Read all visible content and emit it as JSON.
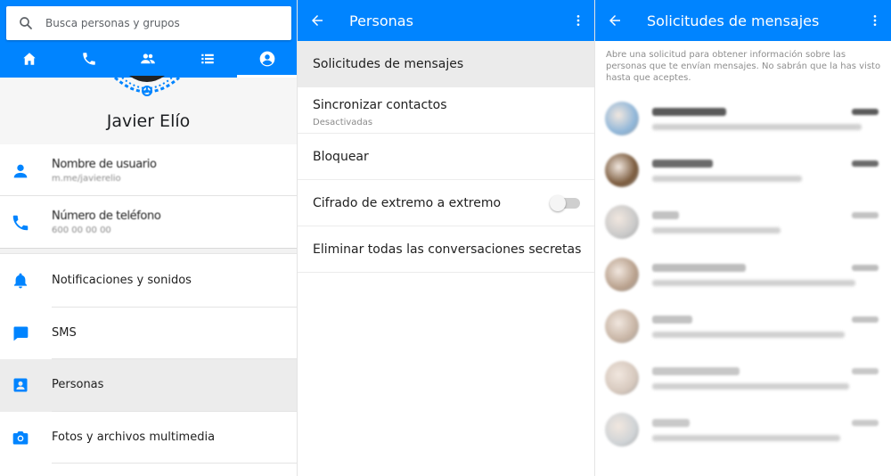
{
  "colors": {
    "brand": "#0084ff",
    "icon_blue": "#0084ff"
  },
  "panel1": {
    "search_placeholder": "Busca personas y grupos",
    "tabs": [
      {
        "icon": "home-icon"
      },
      {
        "icon": "phone-icon"
      },
      {
        "icon": "people-icon"
      },
      {
        "icon": "list-icon"
      },
      {
        "icon": "account-circle-icon",
        "active": true
      }
    ],
    "profile_name": "Javier Elío",
    "info_rows": [
      {
        "icon": "person-icon",
        "title": "Nombre de usuario",
        "value": "m.me/javierelio"
      },
      {
        "icon": "phone-icon",
        "title": "Número de teléfono",
        "value": "600 00 00 00"
      }
    ],
    "settings": [
      {
        "icon": "bell-icon",
        "label": "Notificaciones y sonidos"
      },
      {
        "icon": "sms-icon",
        "label": "SMS"
      },
      {
        "icon": "contact-card-icon",
        "label": "Personas",
        "selected": true
      },
      {
        "icon": "camera-icon",
        "label": "Fotos y archivos multimedia"
      }
    ]
  },
  "panel2": {
    "title": "Personas",
    "items": [
      {
        "label": "Solicitudes de mensajes",
        "selected": true
      },
      {
        "label": "Sincronizar contactos",
        "sub": "Desactivadas"
      },
      {
        "label": "Bloquear"
      },
      {
        "label": "Cifrado de extremo a extremo",
        "toggle": false
      },
      {
        "label": "Eliminar todas las conversaciones secretas"
      }
    ]
  },
  "panel3": {
    "title": "Solicitudes de mensajes",
    "info": "Abre una solicitud para obtener información sobre las personas que te envían mensajes. No sabrán que la has visto hasta que aceptes.",
    "requests": [
      {
        "color": "#8fb6d9",
        "name_w": 0.55,
        "preview_w": 0.98,
        "ink": "#5a5a5a"
      },
      {
        "color": "#7a5a3c",
        "name_w": 0.45,
        "preview_w": 0.7,
        "ink": "#6a6a6a"
      },
      {
        "color": "#c9c9c9",
        "name_w": 0.2,
        "preview_w": 0.6,
        "ink": "#c2c2c2"
      },
      {
        "color": "#b8a08c",
        "name_w": 0.7,
        "preview_w": 0.95,
        "ink": "#bdbdbd"
      },
      {
        "color": "#c7b4a4",
        "name_w": 0.3,
        "preview_w": 0.9,
        "ink": "#c2c2c2"
      },
      {
        "color": "#d6c8bd",
        "name_w": 0.65,
        "preview_w": 0.92,
        "ink": "#c7c7c7"
      },
      {
        "color": "#cfd3d6",
        "name_w": 0.28,
        "preview_w": 0.88,
        "ink": "#c9c9c9"
      }
    ]
  }
}
